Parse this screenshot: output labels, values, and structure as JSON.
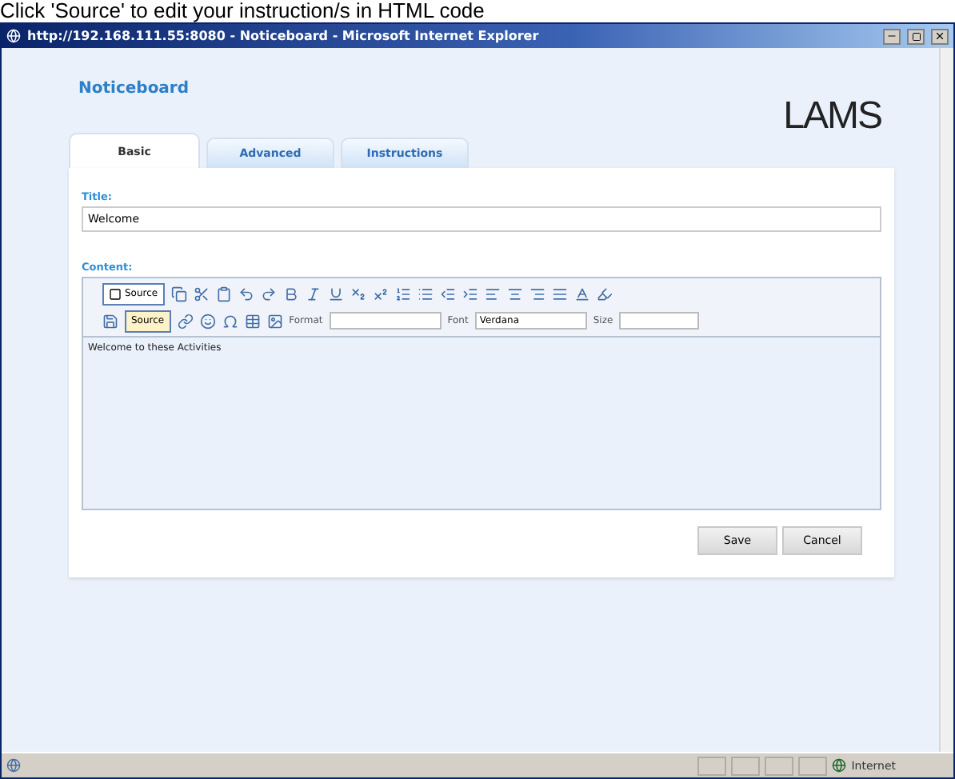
{
  "caption": "Click 'Source' to edit your instruction/s in HTML code",
  "window": {
    "title": "http://192.168.111.55:8080 - Noticeboard - Microsoft Internet Explorer"
  },
  "page": {
    "heading": "Noticeboard",
    "logo": "LAMS"
  },
  "tabs": [
    {
      "label": "Basic",
      "selected": true
    },
    {
      "label": "Advanced",
      "selected": false
    },
    {
      "label": "Instructions",
      "selected": false
    }
  ],
  "form": {
    "title_label": "Title:",
    "title_value": "Welcome",
    "content_label": "Content:"
  },
  "editor": {
    "source_button": "Source",
    "row2_button": "Source",
    "format_label": "Format",
    "font_label": "Font",
    "font_value": "Verdana",
    "size_label": "Size",
    "text": "Welcome to these Activities"
  },
  "buttons": [
    "Save",
    "Cancel"
  ],
  "status_bar": {
    "zone": "Internet"
  }
}
